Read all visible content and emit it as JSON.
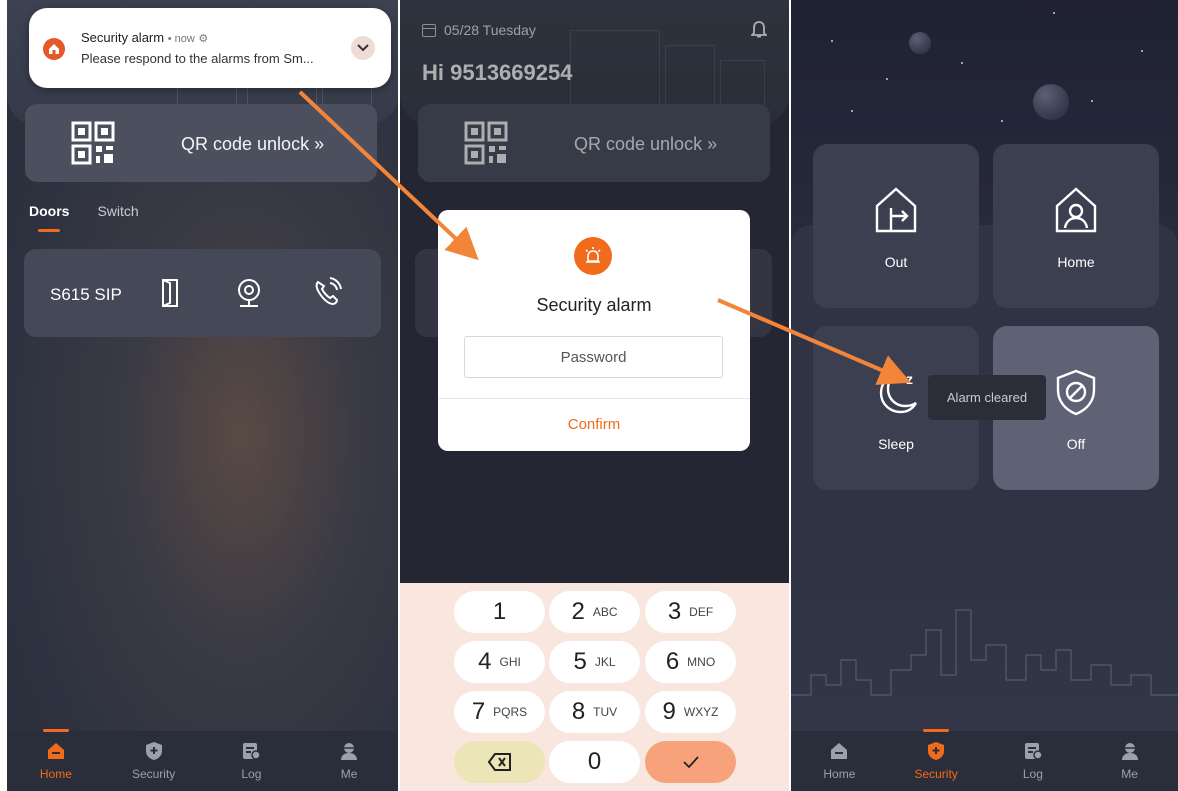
{
  "screen1": {
    "notification": {
      "title": "Security alarm",
      "meta": "• now",
      "body": "Please respond to the alarms from Sm..."
    },
    "qr_label": "QR code unlock »",
    "tabs": [
      "Doors",
      "Switch"
    ],
    "door_name": "S615 SIP",
    "nav": [
      "Home",
      "Security",
      "Log",
      "Me"
    ],
    "active_nav": "Home"
  },
  "screen2": {
    "date": "05/28 Tuesday",
    "greeting": "Hi 9513669254",
    "qr_label": "QR code unlock »",
    "dialog": {
      "title": "Security alarm",
      "password_placeholder": "Password",
      "confirm_label": "Confirm"
    },
    "keypad": [
      {
        "num": "1",
        "letters": ""
      },
      {
        "num": "2",
        "letters": "ABC"
      },
      {
        "num": "3",
        "letters": "DEF"
      },
      {
        "num": "4",
        "letters": "GHI"
      },
      {
        "num": "5",
        "letters": "JKL"
      },
      {
        "num": "6",
        "letters": "MNO"
      },
      {
        "num": "7",
        "letters": "PQRS"
      },
      {
        "num": "8",
        "letters": "TUV"
      },
      {
        "num": "9",
        "letters": "WXYZ"
      },
      {
        "num": "0",
        "letters": ""
      }
    ],
    "keypad_icons": {
      "delete": "backspace-icon",
      "confirm": "check-icon"
    }
  },
  "screen3": {
    "modes": [
      {
        "label": "Out",
        "icon": "house-exit-icon"
      },
      {
        "label": "Home",
        "icon": "house-person-icon"
      },
      {
        "label": "Sleep",
        "icon": "moon-icon"
      },
      {
        "label": "Off",
        "icon": "shield-off-icon"
      }
    ],
    "active_mode": "Off",
    "toast": "Alarm cleared",
    "nav": [
      "Home",
      "Security",
      "Log",
      "Me"
    ],
    "active_nav": "Security"
  },
  "colors": {
    "accent": "#f26a1b",
    "arrow": "#f2853a"
  }
}
